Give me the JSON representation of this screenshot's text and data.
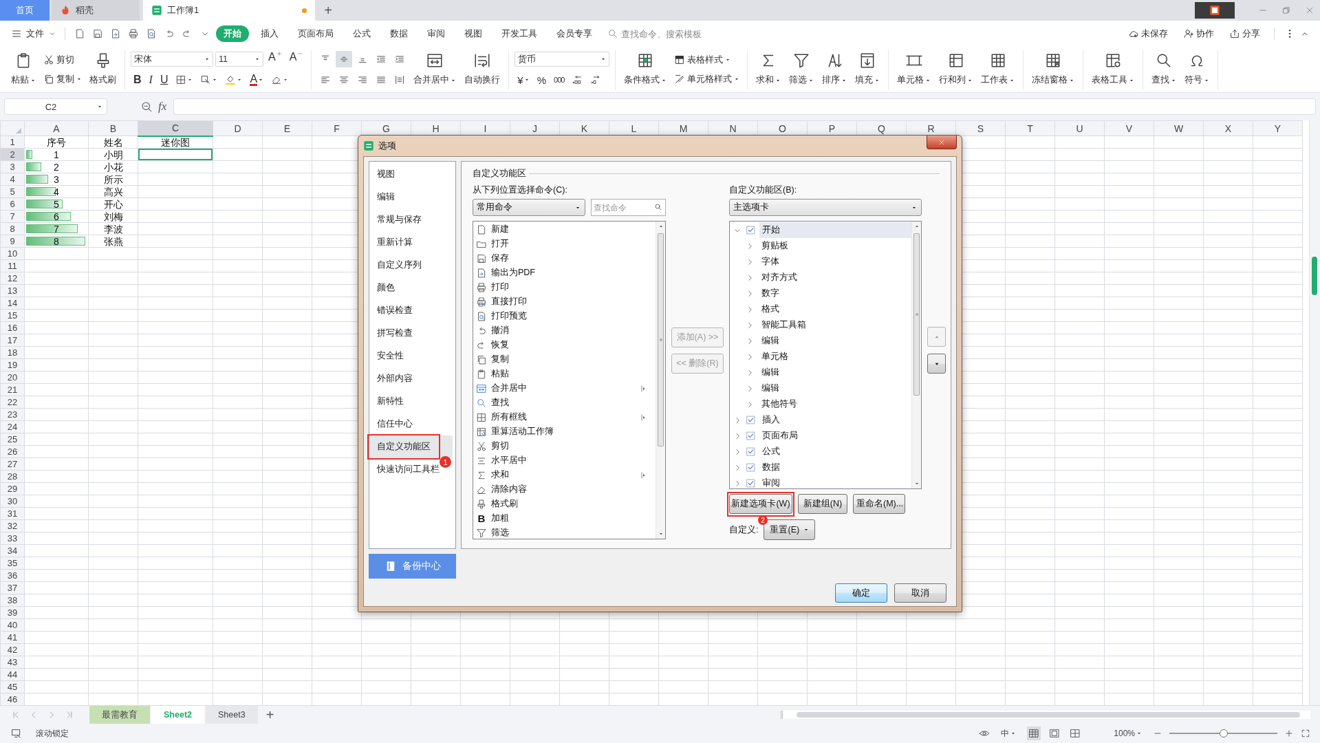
{
  "title_bar": {
    "tabs": [
      {
        "label": "首页",
        "kind": "home",
        "selected": false,
        "unsaved": false
      },
      {
        "label": "稻壳",
        "kind": "docer",
        "selected": false,
        "unsaved": false
      },
      {
        "label": "工作簿1",
        "kind": "sheet",
        "selected": true,
        "unsaved": true
      }
    ],
    "new_tab": "+"
  },
  "menu_bar": {
    "file": "文件",
    "tabs": [
      {
        "label": "开始",
        "selected": true
      },
      {
        "label": "插入",
        "selected": false
      },
      {
        "label": "页面布局",
        "selected": false
      },
      {
        "label": "公式",
        "selected": false
      },
      {
        "label": "数据",
        "selected": false
      },
      {
        "label": "审阅",
        "selected": false
      },
      {
        "label": "视图",
        "selected": false
      },
      {
        "label": "开发工具",
        "selected": false
      },
      {
        "label": "会员专享",
        "selected": false
      }
    ],
    "search": {
      "placeholder": "查找命令、搜索模板"
    },
    "actions": [
      "未保存",
      "协作",
      "分享"
    ]
  },
  "ribbon": {
    "clipboard": {
      "paste": "粘贴",
      "cut": "剪切",
      "copy": "复制",
      "format_painter": "格式刷"
    },
    "font": {
      "name": "宋体",
      "size": "11",
      "grow": "A",
      "shrink": "A",
      "bold": "B",
      "italic": "I",
      "underline": "U",
      "font_color": "A"
    },
    "alignment": {
      "middle_aligned": true,
      "merge": "合并居中",
      "wrap": "自动换行"
    },
    "number": {
      "format": "货币",
      "currency": "¥",
      "percent": "%",
      "thousands": "000"
    },
    "styles": {
      "conditional": "条件格式",
      "table_style": "表格样式",
      "cell_style": "单元格样式"
    },
    "tools": [
      {
        "label": "求和",
        "kind": "sum"
      },
      {
        "label": "筛选",
        "kind": "filter"
      },
      {
        "label": "排序",
        "kind": "sort"
      },
      {
        "label": "填充",
        "kind": "fill"
      },
      {
        "label": "单元格",
        "kind": "cell"
      },
      {
        "label": "行和列",
        "kind": "rowcol"
      },
      {
        "label": "工作表",
        "kind": "sheet"
      },
      {
        "label": "冻结窗格",
        "kind": "freeze"
      },
      {
        "label": "表格工具",
        "kind": "tabletool"
      },
      {
        "label": "查找",
        "kind": "find"
      },
      {
        "label": "符号",
        "kind": "symbol"
      }
    ]
  },
  "name_box": "C2",
  "formula_label": "fx",
  "columns": [
    {
      "label": "A",
      "selected": false
    },
    {
      "label": "B",
      "selected": false
    },
    {
      "label": "C",
      "selected": true
    },
    {
      "label": "D",
      "selected": false
    },
    {
      "label": "E",
      "selected": false
    },
    {
      "label": "F",
      "selected": false
    },
    {
      "label": "G",
      "selected": false
    },
    {
      "label": "H",
      "selected": false
    },
    {
      "label": "I",
      "selected": false
    },
    {
      "label": "J",
      "selected": false
    },
    {
      "label": "K",
      "selected": false
    },
    {
      "label": "L",
      "selected": false
    },
    {
      "label": "M",
      "selected": false
    },
    {
      "label": "N",
      "selected": false
    },
    {
      "label": "O",
      "selected": false
    },
    {
      "label": "P",
      "selected": false
    },
    {
      "label": "Q",
      "selected": false
    },
    {
      "label": "R",
      "selected": false
    },
    {
      "label": "S",
      "selected": false
    },
    {
      "label": "T",
      "selected": false
    },
    {
      "label": "U",
      "selected": false
    },
    {
      "label": "V",
      "selected": false
    },
    {
      "label": "W",
      "selected": false
    },
    {
      "label": "X",
      "selected": false
    },
    {
      "label": "Y",
      "selected": false
    }
  ],
  "rows": [
    {
      "header": "1",
      "selected": false,
      "cells": [
        {
          "text": "序号",
          "selected": false
        },
        {
          "text": "姓名",
          "selected": false
        },
        {
          "text": "迷你图",
          "selected": false
        }
      ]
    },
    {
      "header": "2",
      "selected": true,
      "cells": [
        {
          "text": "1",
          "level": 0.11,
          "selected": false
        },
        {
          "text": "小明",
          "selected": false
        },
        {
          "selected": true
        }
      ]
    },
    {
      "header": "3",
      "selected": false,
      "cells": [
        {
          "text": "2",
          "level": 0.25,
          "selected": false
        },
        {
          "text": "小花",
          "selected": false
        },
        {
          "selected": false
        }
      ]
    },
    {
      "header": "4",
      "selected": false,
      "cells": [
        {
          "text": "3",
          "level": 0.37,
          "selected": false
        },
        {
          "text": "所示",
          "selected": false
        },
        {
          "selected": false
        }
      ]
    },
    {
      "header": "5",
      "selected": false,
      "cells": [
        {
          "text": "4",
          "level": 0.5,
          "selected": false
        },
        {
          "text": "高兴",
          "selected": false
        },
        {
          "selected": false
        }
      ]
    },
    {
      "header": "6",
      "selected": false,
      "cells": [
        {
          "text": "5",
          "level": 0.62,
          "selected": false
        },
        {
          "text": "开心",
          "selected": false
        },
        {
          "selected": false
        }
      ]
    },
    {
      "header": "7",
      "selected": false,
      "cells": [
        {
          "text": "6",
          "level": 0.75,
          "selected": false
        },
        {
          "text": "刘梅",
          "selected": false
        },
        {
          "selected": false
        }
      ]
    },
    {
      "header": "8",
      "selected": false,
      "cells": [
        {
          "text": "7",
          "level": 0.87,
          "selected": false
        },
        {
          "text": "李波",
          "selected": false
        },
        {
          "selected": false
        }
      ]
    },
    {
      "header": "9",
      "selected": false,
      "cells": [
        {
          "text": "8",
          "level": 1,
          "selected": false
        },
        {
          "text": "张燕",
          "selected": false
        },
        {
          "selected": false
        }
      ]
    },
    {
      "header": "10",
      "selected": false
    },
    {
      "header": "11",
      "selected": false
    },
    {
      "header": "12",
      "selected": false
    },
    {
      "header": "13",
      "selected": false
    },
    {
      "header": "14",
      "selected": false
    },
    {
      "header": "15",
      "selected": false
    },
    {
      "header": "16",
      "selected": false
    },
    {
      "header": "17",
      "selected": false
    },
    {
      "header": "18",
      "selected": false
    },
    {
      "header": "19",
      "selected": false
    },
    {
      "header": "20",
      "selected": false
    },
    {
      "header": "21",
      "selected": false
    },
    {
      "header": "22",
      "selected": false
    },
    {
      "header": "23",
      "selected": false
    },
    {
      "header": "24",
      "selected": false
    },
    {
      "header": "25",
      "selected": false
    },
    {
      "header": "26",
      "selected": false
    },
    {
      "header": "27",
      "selected": false
    },
    {
      "header": "28",
      "selected": false
    },
    {
      "header": "29",
      "selected": false
    },
    {
      "header": "30",
      "selected": false
    },
    {
      "header": "31",
      "selected": false
    },
    {
      "header": "32",
      "selected": false
    },
    {
      "header": "33",
      "selected": false
    },
    {
      "header": "34",
      "selected": false
    },
    {
      "header": "35",
      "selected": false
    },
    {
      "header": "36",
      "selected": false
    },
    {
      "header": "37",
      "selected": false
    },
    {
      "header": "38",
      "selected": false
    },
    {
      "header": "39",
      "selected": false
    },
    {
      "header": "40",
      "selected": false
    },
    {
      "header": "41",
      "selected": false
    },
    {
      "header": "42",
      "selected": false
    },
    {
      "header": "43",
      "selected": false
    },
    {
      "header": "44",
      "selected": false
    },
    {
      "header": "45",
      "selected": false
    },
    {
      "header": "46",
      "selected": false
    }
  ],
  "sheet_tabs": [
    {
      "label": "最需教育",
      "selected": false,
      "color": "#c6e0b4"
    },
    {
      "label": "Sheet2",
      "selected": true
    },
    {
      "label": "Sheet3",
      "selected": false
    }
  ],
  "add_sheet": "+",
  "status_bar": {
    "scroll_lock": "滚动锁定",
    "input_mode": "中",
    "view_modes": [
      {
        "selected": true
      },
      {
        "selected": false
      },
      {
        "selected": false
      }
    ],
    "zoom": "100%",
    "zoom_slider": {
      "level": 0.5
    }
  },
  "dialog": {
    "title": "选项",
    "nav": [
      {
        "label": "视图",
        "selected": false
      },
      {
        "label": "编辑",
        "selected": false
      },
      {
        "label": "常规与保存",
        "selected": false
      },
      {
        "label": "重新计算",
        "selected": false
      },
      {
        "label": "自定义序列",
        "selected": false
      },
      {
        "label": "颜色",
        "selected": false
      },
      {
        "label": "错误检查",
        "selected": false
      },
      {
        "label": "拼写检查",
        "selected": false
      },
      {
        "label": "安全性",
        "selected": false
      },
      {
        "label": "外部内容",
        "selected": false
      },
      {
        "label": "新特性",
        "selected": false
      },
      {
        "label": "信任中心",
        "selected": false
      },
      {
        "label": "自定义功能区",
        "selected": true,
        "callout": "1"
      },
      {
        "label": "快速访问工具栏",
        "selected": false
      }
    ],
    "backup_button": "备份中心",
    "section_title": "自定义功能区",
    "commands_label": "从下列位置选择命令(C):",
    "commands_source": "常用命令",
    "command_search": {
      "placeholder": "查找命令"
    },
    "commands": [
      {
        "label": "新建",
        "kind": "new",
        "submenu": false
      },
      {
        "label": "打开",
        "kind": "open",
        "submenu": false
      },
      {
        "label": "保存",
        "kind": "save",
        "submenu": false
      },
      {
        "label": "输出为PDF",
        "kind": "export",
        "submenu": false
      },
      {
        "label": "打印",
        "kind": "print",
        "submenu": false
      },
      {
        "label": "直接打印",
        "kind": "print_direct",
        "submenu": false
      },
      {
        "label": "打印预览",
        "kind": "preview",
        "submenu": false
      },
      {
        "label": "撤消",
        "kind": "undo",
        "submenu": false
      },
      {
        "label": "恢复",
        "kind": "redo",
        "submenu": false
      },
      {
        "label": "复制",
        "kind": "copy",
        "submenu": false
      },
      {
        "label": "粘贴",
        "kind": "paste",
        "submenu": false
      },
      {
        "label": "合并居中",
        "kind": "merge",
        "submenu": true
      },
      {
        "label": "查找",
        "kind": "find",
        "submenu": false
      },
      {
        "label": "所有框线",
        "kind": "borders",
        "submenu": true
      },
      {
        "label": "重算活动工作簿",
        "kind": "recalc",
        "submenu": false
      },
      {
        "label": "剪切",
        "kind": "cut",
        "submenu": false
      },
      {
        "label": "水平居中",
        "kind": "center",
        "submenu": false
      },
      {
        "label": "求和",
        "kind": "sum",
        "submenu": true
      },
      {
        "label": "清除内容",
        "kind": "clear",
        "submenu": false
      },
      {
        "label": "格式刷",
        "kind": "format_painter",
        "submenu": false
      },
      {
        "label": "加粗",
        "kind": "bold",
        "glyph": "B",
        "submenu": false
      },
      {
        "label": "筛选",
        "kind": "filter",
        "submenu": false
      }
    ],
    "transfer_buttons": [
      {
        "label": "添加(A) >>",
        "disabled": true
      },
      {
        "label": "<< 删除(R)",
        "disabled": true
      }
    ],
    "ribbon_label": "自定义功能区(B):",
    "ribbon_source": "主选项卡",
    "ribbon_tree": [
      {
        "label": "开始",
        "checked": true,
        "expanded": true,
        "selected": true,
        "children": [
          {
            "label": "剪贴板",
            "expanded": false
          },
          {
            "label": "字体",
            "expanded": false
          },
          {
            "label": "对齐方式",
            "expanded": false
          },
          {
            "label": "数字",
            "expanded": false
          },
          {
            "label": "格式",
            "expanded": false
          },
          {
            "label": "智能工具箱",
            "expanded": false
          },
          {
            "label": "编辑",
            "expanded": false
          },
          {
            "label": "单元格",
            "expanded": false
          },
          {
            "label": "编辑",
            "expanded": false
          },
          {
            "label": "编辑",
            "expanded": false
          },
          {
            "label": "其他符号",
            "expanded": false
          }
        ]
      },
      {
        "label": "插入",
        "checked": true,
        "expanded": false,
        "selected": false
      },
      {
        "label": "页面布局",
        "checked": true,
        "expanded": false,
        "selected": false
      },
      {
        "label": "公式",
        "checked": true,
        "expanded": false,
        "selected": false
      },
      {
        "label": "数据",
        "checked": true,
        "expanded": false,
        "selected": false
      },
      {
        "label": "审阅",
        "checked": true,
        "expanded": false,
        "selected": false
      }
    ],
    "move_buttons": [
      {
        "disabled": true
      },
      {
        "disabled": false
      }
    ],
    "tree_buttons": [
      {
        "label": "新建选项卡(W)",
        "callout": "2"
      },
      {
        "label": "新建组(N)"
      },
      {
        "label": "重命名(M)..."
      }
    ],
    "customize_label": "自定义:",
    "reset_button": "重置(E)",
    "footer_buttons": [
      {
        "label": "确定",
        "default": true
      },
      {
        "label": "取消",
        "default": false
      }
    ]
  }
}
